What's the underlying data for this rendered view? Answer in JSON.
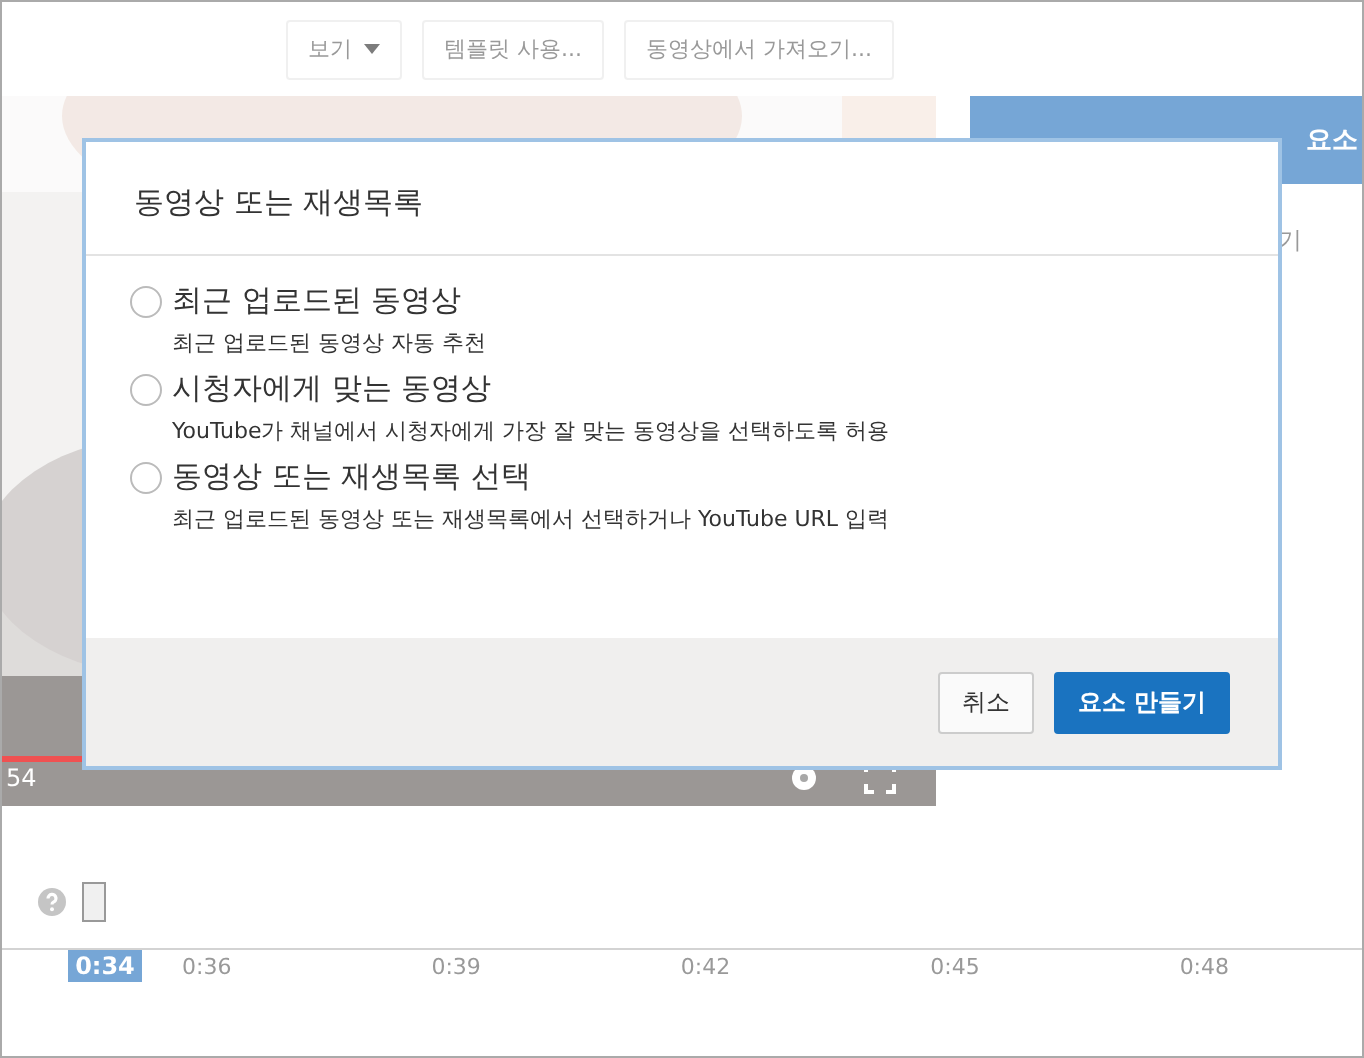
{
  "toolbar": {
    "buttons": [
      {
        "label": "보기",
        "kind": "menu"
      },
      {
        "label": "템플릿 사용...",
        "kind": "plain"
      },
      {
        "label": "동영상에서 가져오기...",
        "kind": "plain"
      }
    ]
  },
  "video": {
    "time": "54"
  },
  "side_panel": {
    "header": "요소",
    "text": "기"
  },
  "timeline": {
    "current": "0:34",
    "ticks": [
      "0:36",
      "0:39",
      "0:42",
      "0:45",
      "0:48"
    ]
  },
  "dialog": {
    "title": "동영상 또는 재생목록",
    "options": [
      {
        "label": "최근 업로드된 동영상",
        "description": "최근 업로드된 동영상 자동 추천",
        "selected": false
      },
      {
        "label": "시청자에게 맞는 동영상",
        "description": "YouTube가 채널에서 시청자에게 가장 잘 맞는 동영상을 선택하도록 허용",
        "selected": false
      },
      {
        "label": "동영상 또는 재생목록 선택",
        "description": "최근 업로드된 동영상 또는 재생목록에서 선택하거나 YouTube URL 입력",
        "selected": false
      }
    ],
    "buttons": [
      {
        "label": "취소",
        "kind": "secondary"
      },
      {
        "label": "요소 만들기",
        "kind": "primary"
      }
    ]
  }
}
